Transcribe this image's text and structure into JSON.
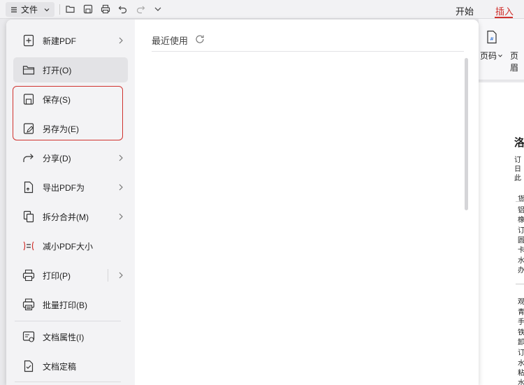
{
  "toolbar": {
    "file_label": "文件",
    "icons": [
      "menu-icon",
      "chevron-down-icon",
      "open-folder-icon",
      "save-icon",
      "print-icon",
      "undo-icon",
      "redo-icon",
      "more-chevron-icon"
    ],
    "tabs": [
      {
        "label": "开始",
        "active": false
      },
      {
        "label": "插入",
        "active": true
      }
    ],
    "accent_color": "#d0322e"
  },
  "ribbon": {
    "items": [
      {
        "label": "页码",
        "has_dropdown": true
      },
      {
        "label": "页眉"
      }
    ]
  },
  "file_menu": {
    "items": [
      {
        "label": "新建PDF",
        "icon": "new-pdf-icon",
        "submenu": true
      },
      {
        "label": "打开(O)",
        "icon": "open-folder-icon",
        "selected": true
      },
      {
        "label": "保存(S)",
        "icon": "save-icon",
        "highlighted": true
      },
      {
        "label": "另存为(E)",
        "icon": "save-as-icon",
        "highlighted": true
      },
      {
        "label": "分享(D)",
        "icon": "share-icon",
        "submenu": true
      },
      {
        "label": "导出PDF为",
        "icon": "export-pdf-icon",
        "submenu": true
      },
      {
        "label": "拆分合并(M)",
        "icon": "split-merge-icon",
        "submenu": true
      },
      {
        "label": "减小PDF大小",
        "icon": "compress-icon"
      },
      {
        "label": "打印(P)",
        "icon": "print-icon",
        "submenu": true
      },
      {
        "label": "批量打印(B)",
        "icon": "batch-print-icon"
      },
      {
        "label": "文档属性(I)",
        "icon": "doc-properties-icon"
      },
      {
        "label": "文档定稿",
        "icon": "finalize-icon"
      }
    ]
  },
  "recent": {
    "title": "最近使用"
  },
  "document_preview": {
    "heading": "洛",
    "lines": [
      "订",
      "日",
      "此",
      "货",
      "铝",
      "橡",
      "订",
      "圆",
      "卡",
      "水",
      "办",
      "观",
      "青",
      "手",
      "铁",
      "卸",
      "订",
      "水",
      "粘",
      "水"
    ]
  }
}
